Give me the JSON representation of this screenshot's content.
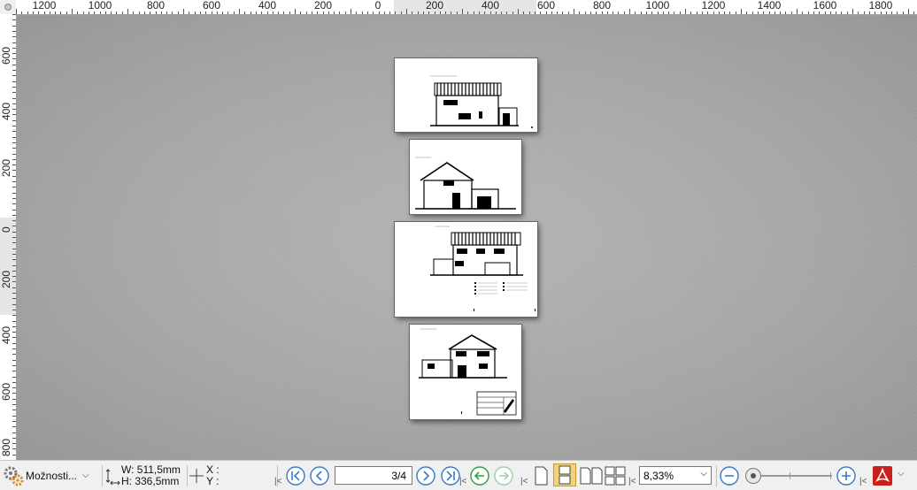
{
  "rulers": {
    "horizontal_labels": [
      "1200",
      "1000",
      "800",
      "600",
      "400",
      "200",
      "0",
      "200",
      "400",
      "600",
      "800",
      "1000",
      "1200",
      "1400",
      "1600",
      "1800"
    ],
    "vertical_labels": [
      "600",
      "400",
      "200",
      "0",
      "200",
      "400",
      "600",
      "800"
    ]
  },
  "pages": [
    {
      "name": "page-1",
      "sheet": "elevation-striped"
    },
    {
      "name": "page-2",
      "sheet": "elevation-gable"
    },
    {
      "name": "page-3",
      "sheet": "elevation-striped-with-legend"
    },
    {
      "name": "page-4",
      "sheet": "elevation-gable-with-titleblock"
    }
  ],
  "statusbar": {
    "options_label": "Možnosti...",
    "width_label": "W: 511,5mm",
    "height_label": "H: 336,5mm",
    "x_label": "X :",
    "y_label": "Y :",
    "page_indicator": "3/4",
    "zoom_value": "8,33%",
    "zoom_slider_level": 0.0,
    "colors": {
      "nav_blue": "#3a78c8",
      "nav_green": "#2e9e44",
      "pdf_red": "#c8201a",
      "active_view": "#f5d27a"
    }
  }
}
